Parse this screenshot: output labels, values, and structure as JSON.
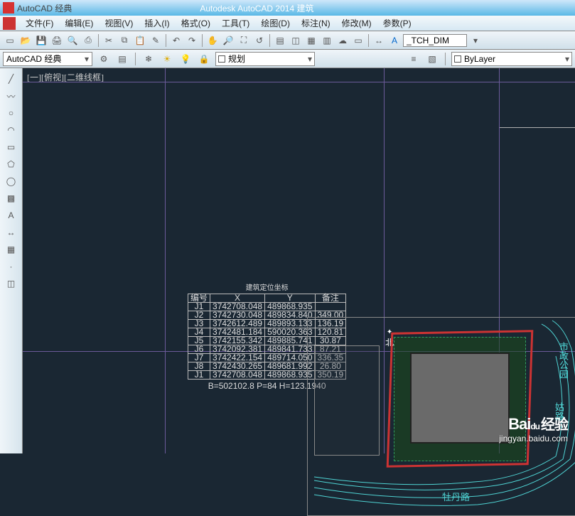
{
  "title_bar": {
    "doc_label": "AutoCAD 经典",
    "app_title": "Autodesk AutoCAD 2014  建筑"
  },
  "menu": {
    "file": "文件(F)",
    "edit": "编辑(E)",
    "view": "视图(V)",
    "insert": "插入(I)",
    "format": "格式(O)",
    "tools": "工具(T)",
    "draw": "绘图(D)",
    "dim": "标注(N)",
    "modify": "修改(M)",
    "param": "参数(P)"
  },
  "toolbar": {
    "style_input": "_TCH_DIM"
  },
  "workspace": {
    "current": "AutoCAD 经典",
    "layer_panel": "规划",
    "layer_dropdown": "ByLayer"
  },
  "canvas": {
    "view_label": "[一][俯视][二维线框]"
  },
  "coord_table": {
    "title": "建筑定位坐标",
    "headers": [
      "编号",
      "X",
      "Y",
      "备注"
    ],
    "rows": [
      [
        "J1",
        "3742708.048",
        "489868.935",
        ""
      ],
      [
        "J2",
        "3742730.048",
        "489834.840",
        "349.00"
      ],
      [
        "J3",
        "3742612.489",
        "489893.133",
        "136.19"
      ],
      [
        "J4",
        "3742481.184",
        "590020.363",
        "120.81"
      ],
      [
        "J5",
        "3742155.342",
        "489885.741",
        "30.87"
      ],
      [
        "J6",
        "3742092.381",
        "489841.733",
        "87.21"
      ],
      [
        "J7",
        "3742422.154",
        "489714.050",
        "336.35"
      ],
      [
        "J8",
        "3742430.265",
        "489681.992",
        "26.80"
      ],
      [
        "J1",
        "3742708.048",
        "489868.935",
        "350.19"
      ]
    ],
    "footer": "B=502102.8  P=84  H=123.1940"
  },
  "site_plan": {
    "road_east": "市政公园",
    "road_east2": "姑路",
    "road_south": "牡丹路",
    "north_label": "北"
  },
  "watermark": {
    "brand": "Baidu经验",
    "url": "jingyan.baidu.com"
  }
}
